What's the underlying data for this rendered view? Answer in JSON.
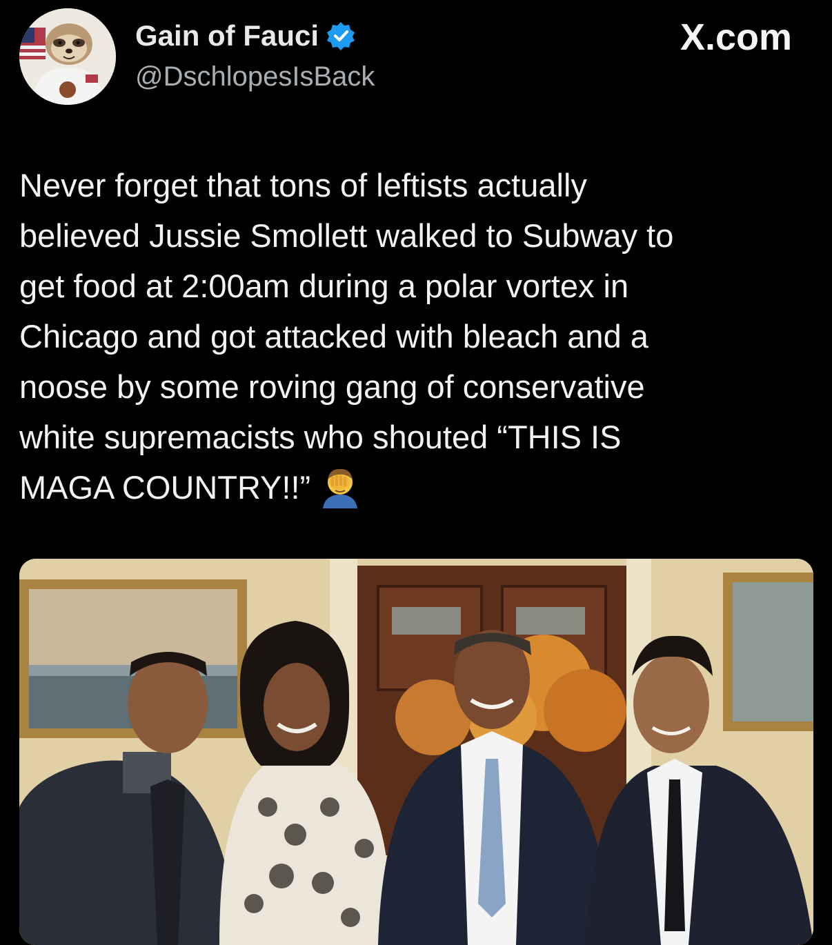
{
  "author": {
    "display_name": "Gain of Fauci",
    "handle": "@DschlopesIsBack",
    "verified": true,
    "avatar_icon": "sloth-astronaut-avatar-icon"
  },
  "watermark": "X.com",
  "tweet": {
    "text": "Never forget that tons of leftists actually\nbelieved Jussie Smollett walked to Subway to\nget food at 2:00am during a polar vortex in\nChicago and got attacked with bleach and a\nnoose by some roving gang of conservative\nwhite supremacists who shouted “THIS IS\nMAGA COUNTRY!!”",
    "emoji": "facepalm-emoji"
  },
  "media": {
    "description_icon": "group-photo-image"
  },
  "colors": {
    "background": "#000000",
    "text_primary": "#e7e9ea",
    "text_secondary": "#a9aeb3",
    "verified_blue": "#1d9bf0"
  }
}
